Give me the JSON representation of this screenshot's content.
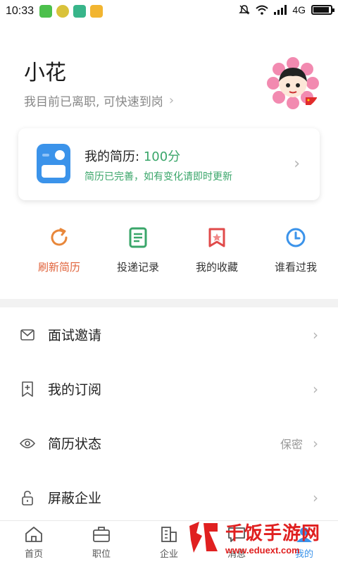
{
  "statusbar": {
    "time": "10:33",
    "network": "4G"
  },
  "profile": {
    "name": "小花",
    "status": "我目前已离职, 可快速到岗"
  },
  "resume_card": {
    "title": "我的简历:",
    "score": "100分",
    "subtitle": "简历已完善，如有变化请即时更新"
  },
  "actions": [
    {
      "label": "刷新简历",
      "icon": "refresh-icon",
      "color": "#e0623a"
    },
    {
      "label": "投递记录",
      "icon": "document-icon",
      "color": "#3aa66a"
    },
    {
      "label": "我的收藏",
      "icon": "bookmark-star-icon",
      "color": "#e04a4a"
    },
    {
      "label": "谁看过我",
      "icon": "clock-icon",
      "color": "#3b93ea"
    }
  ],
  "menu": [
    {
      "label": "面试邀请",
      "icon": "mail-icon",
      "value": ""
    },
    {
      "label": "我的订阅",
      "icon": "bookmark-plus-icon",
      "value": ""
    },
    {
      "label": "简历状态",
      "icon": "eye-icon",
      "value": "保密"
    },
    {
      "label": "屏蔽企业",
      "icon": "lock-icon",
      "value": ""
    }
  ],
  "bottomnav": [
    {
      "label": "首页",
      "icon": "home-icon"
    },
    {
      "label": "职位",
      "icon": "briefcase-icon"
    },
    {
      "label": "企业",
      "icon": "building-icon"
    },
    {
      "label": "消息",
      "icon": "message-icon"
    },
    {
      "label": "我的",
      "icon": "user-icon"
    }
  ],
  "watermark": {
    "title": "千饭手游网",
    "url": "www.eduext.com"
  },
  "colors": {
    "accent_blue": "#3b93ea",
    "green": "#3aa66a",
    "orange": "#e0623a"
  }
}
